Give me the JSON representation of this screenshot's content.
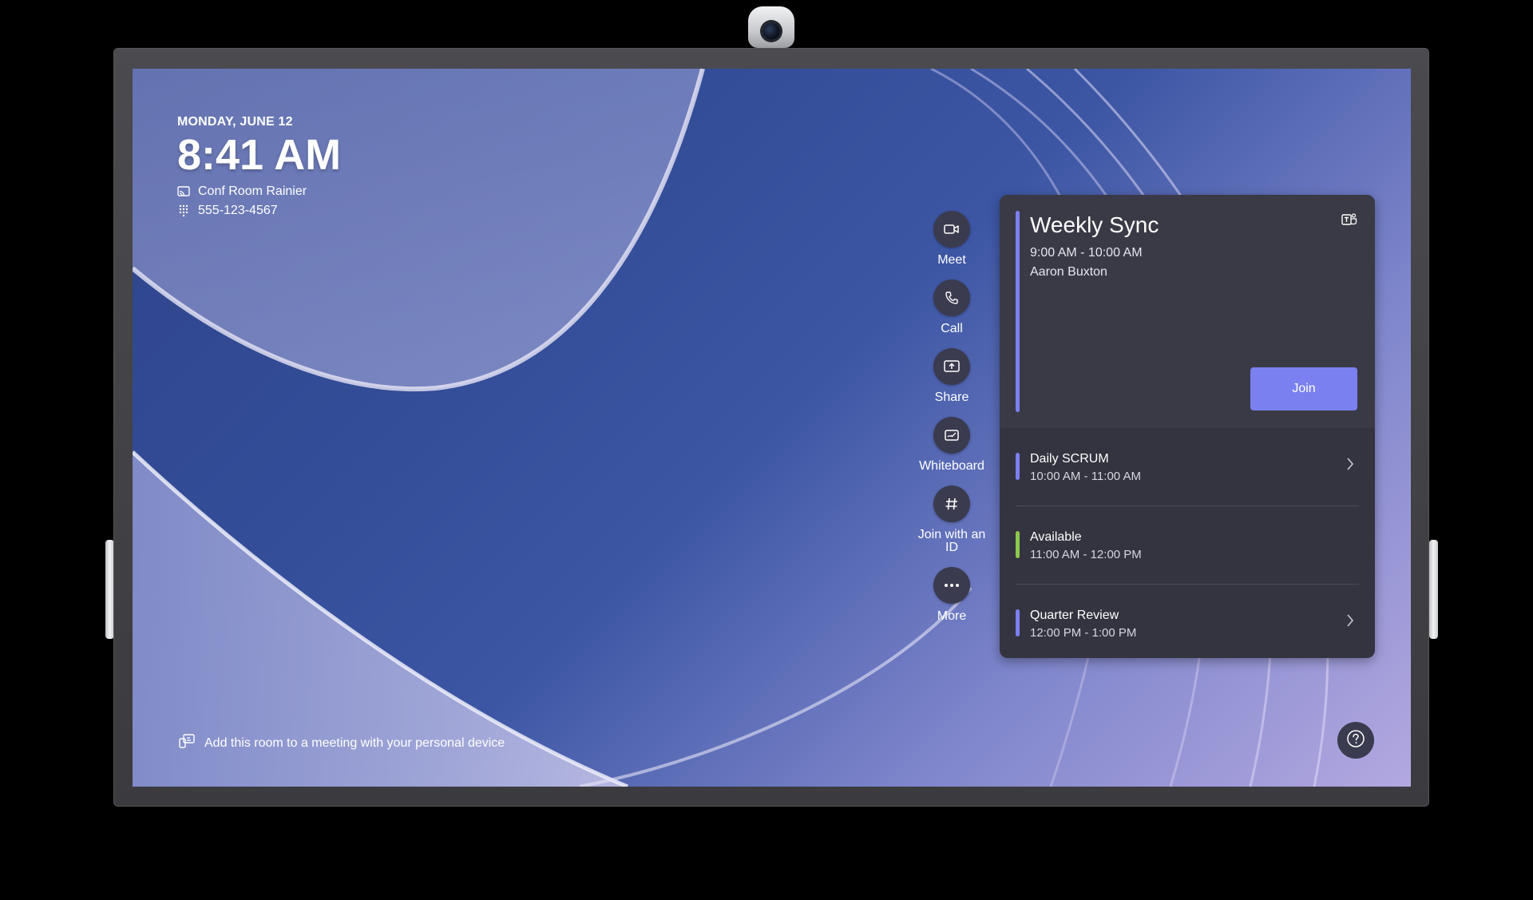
{
  "status": {
    "date": "MONDAY, JUNE 12",
    "time": "8:41 AM",
    "room_name": "Conf Room Rainier",
    "phone": "555-123-4567"
  },
  "actions": [
    {
      "label": "Meet",
      "icon": "video-camera-icon"
    },
    {
      "label": "Call",
      "icon": "phone-icon"
    },
    {
      "label": "Share",
      "icon": "share-screen-icon"
    },
    {
      "label": "Whiteboard",
      "icon": "whiteboard-icon"
    },
    {
      "label": "Join with an ID",
      "icon": "hash-icon"
    },
    {
      "label": "More",
      "icon": "more-icon"
    }
  ],
  "current_meeting": {
    "title": "Weekly Sync",
    "time": "9:00 AM - 10:00 AM",
    "organizer": "Aaron Buxton",
    "join_label": "Join",
    "accent": "#7b80f0"
  },
  "agenda": [
    {
      "name": "Daily SCRUM",
      "time": "10:00 AM - 11:00 AM",
      "color": "#7b80f0",
      "chevron": true
    },
    {
      "name": "Available",
      "time": "11:00 AM - 12:00 PM",
      "color": "#8cc84b",
      "chevron": false
    },
    {
      "name": "Quarter Review",
      "time": "12:00 PM - 1:00 PM",
      "color": "#7b80f0",
      "chevron": true
    }
  ],
  "footer": {
    "hint": "Add this room to a meeting with your personal device",
    "help_icon": "help-icon"
  }
}
